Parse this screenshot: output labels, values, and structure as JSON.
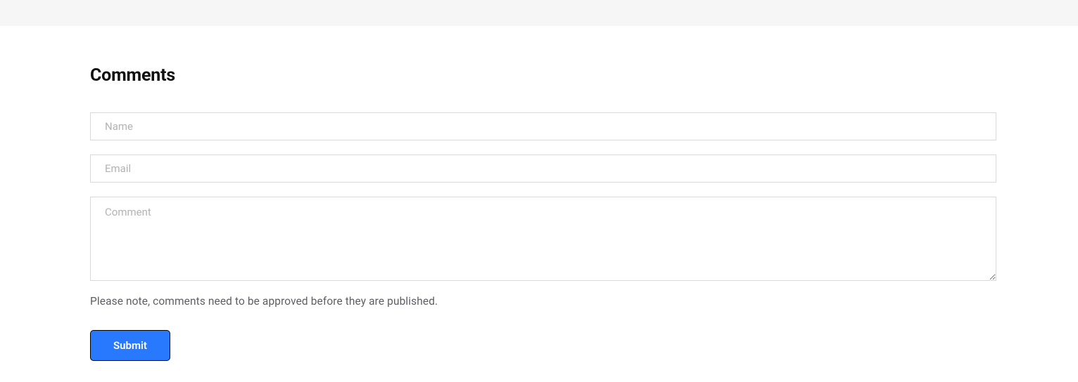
{
  "comments": {
    "heading": "Comments",
    "name_placeholder": "Name",
    "email_placeholder": "Email",
    "comment_placeholder": "Comment",
    "approval_note": "Please note, comments need to be approved before they are published.",
    "submit_label": "Submit"
  }
}
